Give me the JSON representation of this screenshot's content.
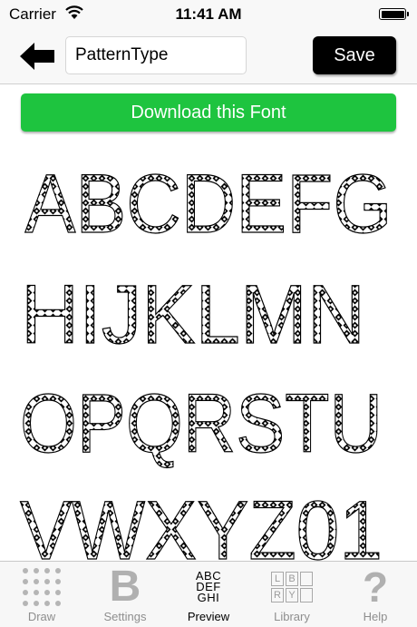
{
  "status_bar": {
    "carrier": "Carrier",
    "time": "11:41 AM"
  },
  "toolbar": {
    "back_icon": "left-arrow-icon",
    "name_field_value": "PatternType",
    "save_label": "Save"
  },
  "download_button": {
    "label": "Download this Font",
    "color": "#1ec43f"
  },
  "preview": {
    "rows": [
      "ABCDEFG",
      "HIJKLMN",
      "OPQRSTU",
      "VWXYZ01"
    ],
    "pattern": "black-diamond-lattice"
  },
  "tabbar": {
    "active": "Preview",
    "tabs": [
      {
        "label": "Draw",
        "icon": "dot-grid-icon"
      },
      {
        "label": "Settings",
        "icon": "letter-b-icon"
      },
      {
        "label": "Preview",
        "icon": "abc-preview-icon",
        "icon_lines": [
          "ABC",
          "DEF",
          "GHI"
        ]
      },
      {
        "label": "Library",
        "icon": "library-icon",
        "icon_letters": [
          "L",
          "B",
          "",
          "R",
          "Y",
          ""
        ]
      },
      {
        "label": "Help",
        "icon": "question-mark-icon",
        "icon_text": "?"
      }
    ]
  }
}
